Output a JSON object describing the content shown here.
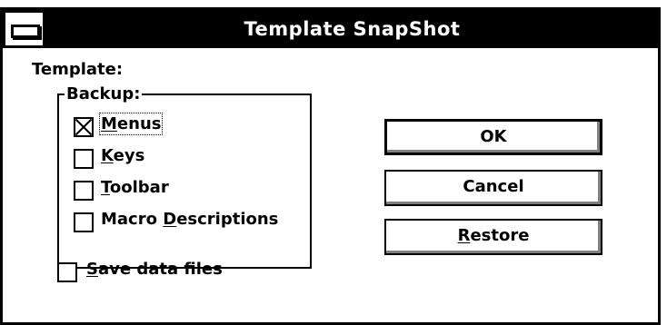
{
  "window": {
    "title": "Template SnapShot"
  },
  "dialog": {
    "template_label": "Template:",
    "backup_group": {
      "label": "Backup:",
      "options": [
        {
          "prefix": "",
          "accel": "M",
          "rest": "enus",
          "checked": true
        },
        {
          "prefix": "",
          "accel": "K",
          "rest": "eys",
          "checked": false
        },
        {
          "prefix": "",
          "accel": "T",
          "rest": "oolbar",
          "checked": false
        },
        {
          "prefix": "Macro ",
          "accel": "D",
          "rest": "escriptions",
          "checked": false
        }
      ]
    },
    "save_data_files": {
      "prefix": "",
      "accel": "S",
      "rest": "ave data files",
      "checked": false
    },
    "buttons": {
      "ok": {
        "prefix": "OK",
        "accel": "",
        "rest": ""
      },
      "cancel": {
        "prefix": "Cancel",
        "accel": "",
        "rest": ""
      },
      "restore": {
        "prefix": "",
        "accel": "R",
        "rest": "estore"
      }
    }
  }
}
